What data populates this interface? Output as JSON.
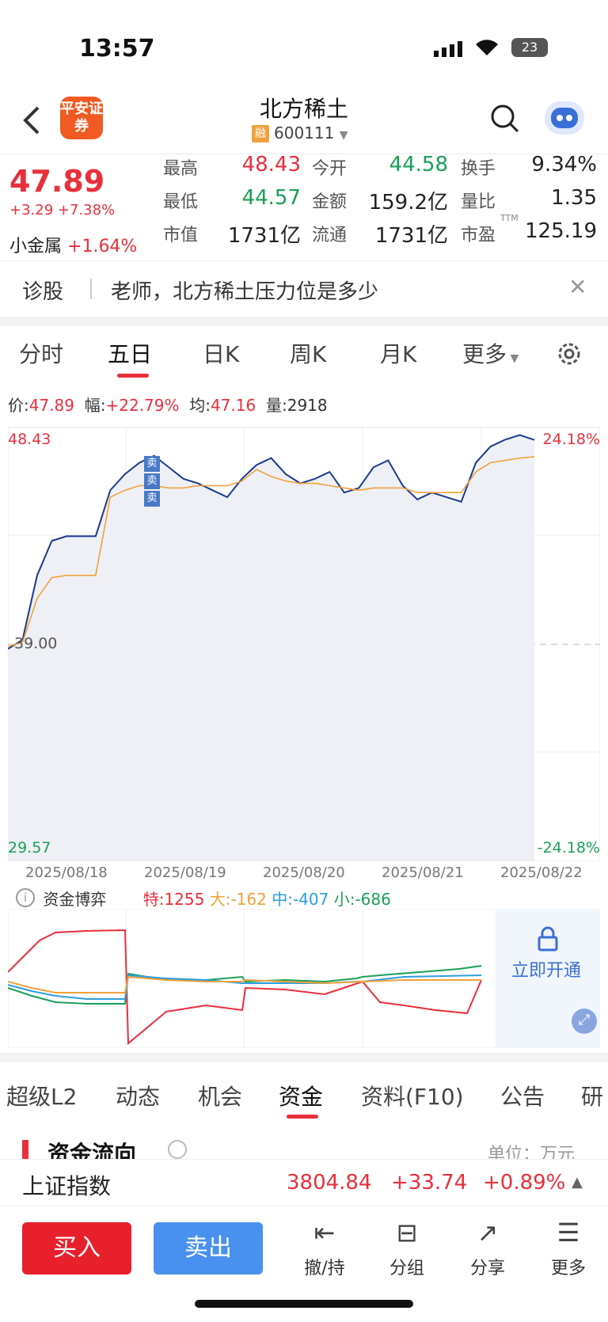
{
  "status": {
    "time": "13:57",
    "battery": "23"
  },
  "header": {
    "back_icon": "back-arrow-icon",
    "logo_text": "平安证券",
    "title": "北方稀土",
    "rong": "融",
    "code": "600111"
  },
  "quote": {
    "price": "47.89",
    "change": "+3.29",
    "change_pct": "+7.38%",
    "sector_name": "小金属",
    "sector_pct": "+1.64%",
    "high_label": "最高",
    "high": "48.43",
    "open_label": "今开",
    "open": "44.58",
    "turnover_label": "换手",
    "turnover": "9.34%",
    "low_label": "最低",
    "low": "44.57",
    "amount_label": "金额",
    "amount": "159.2亿",
    "vol_ratio_label": "量比",
    "vol_ratio": "1.35",
    "mktcap_label": "市值",
    "mktcap": "1731亿",
    "float_label": "流通",
    "float": "1731亿",
    "pe_label": "市盈",
    "pe_sup": "TTM",
    "pe": "125.19"
  },
  "diagnose": {
    "label": "诊股",
    "question": "老师，北方稀土压力位是多少"
  },
  "chart_tabs": [
    "分时",
    "五日",
    "日K",
    "周K",
    "月K",
    "更多"
  ],
  "info": {
    "price_label": "价:",
    "price": "47.89",
    "range_label": "幅:",
    "range": "+22.79%",
    "avg_label": "均:",
    "avg": "47.16",
    "vol_label": "量:",
    "vol": "2918"
  },
  "chart_data": {
    "type": "line",
    "ylim": [
      29.57,
      48.43
    ],
    "y_labels": {
      "top": "48.43",
      "mid": "39.00",
      "bottom": "29.57",
      "top_pct": "24.18%",
      "bottom_pct": "-24.18%"
    },
    "dates": [
      "2025/08/18",
      "2025/08/19",
      "2025/08/20",
      "2025/08/21",
      "2025/08/22"
    ],
    "series": [
      {
        "values": [
          38.8,
          39.2,
          42.0,
          43.5,
          43.7,
          43.7,
          43.7,
          45.7,
          46.4,
          46.9,
          47.2,
          46.7,
          46.2,
          46.0,
          45.7,
          45.4,
          46.2,
          46.8,
          47.1,
          46.4,
          46.0,
          46.2,
          46.5,
          45.6,
          45.8,
          46.7,
          47.0,
          45.9,
          45.3,
          45.6,
          45.4,
          45.2,
          46.9,
          47.6,
          47.9,
          48.1,
          47.89
        ],
        "color": "#1c3a8f"
      },
      {
        "values": [
          38.9,
          39.1,
          41.0,
          41.9,
          42.0,
          42.0,
          42.0,
          45.4,
          45.7,
          45.9,
          45.9,
          45.8,
          45.8,
          45.9,
          45.9,
          45.9,
          46.1,
          46.6,
          46.3,
          46.1,
          46.0,
          46.0,
          45.9,
          45.8,
          45.7,
          45.8,
          45.8,
          45.8,
          45.6,
          45.6,
          45.6,
          45.6,
          46.5,
          46.9,
          47.0,
          47.1,
          47.16
        ],
        "color": "#f0a03c"
      }
    ]
  },
  "fund": {
    "title": "资金博弈",
    "te": "特:1255",
    "da": "大:-162",
    "zhong": "中:-407",
    "xiao": "小:-686",
    "unlock": "立即开通"
  },
  "bottom_tabs": [
    "超级L2",
    "动态",
    "机会",
    "资金",
    "资料(F10)",
    "公告",
    "研"
  ],
  "section": {
    "title": "资金流向",
    "unit": "单位：万元"
  },
  "index": {
    "name": "上证指数",
    "value": "3804.84",
    "change": "+33.74",
    "pct": "+0.89%"
  },
  "actions": {
    "buy": "买入",
    "sell": "卖出",
    "tools": [
      "撤/持",
      "分组",
      "分享",
      "更多"
    ]
  }
}
